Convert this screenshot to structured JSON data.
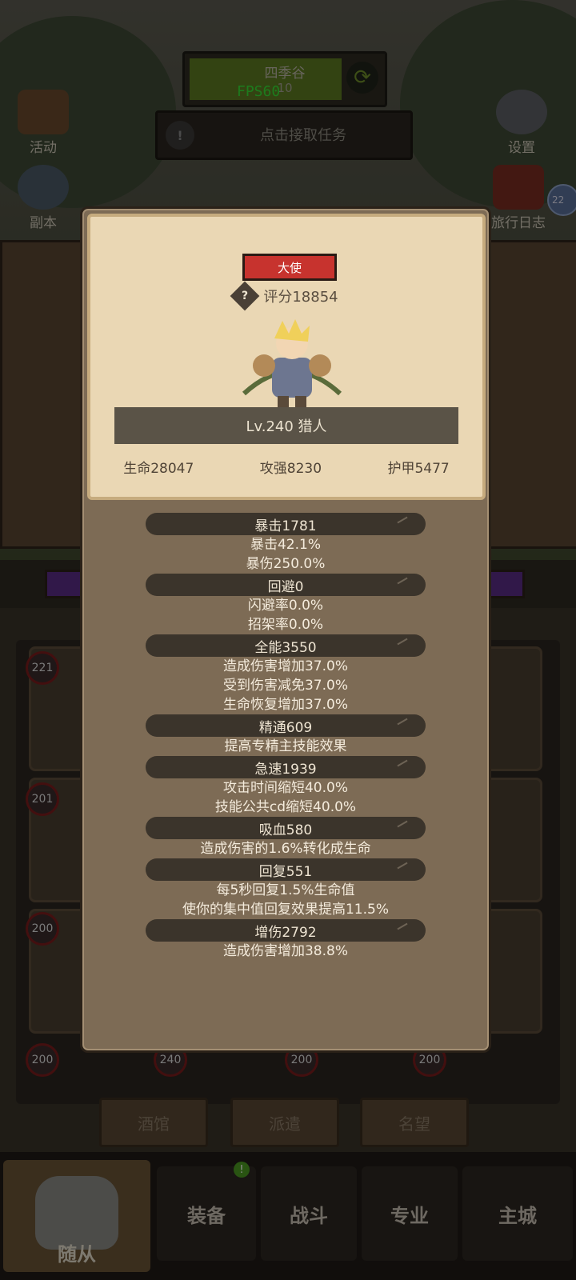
{
  "hud": {
    "zone_name": "四季谷",
    "zone_sub": "10",
    "fps": "FPS60",
    "quest_label": "点击接取任务"
  },
  "side": {
    "left": [
      {
        "label": "活动"
      },
      {
        "label": "副本"
      }
    ],
    "right": [
      {
        "label": "设置"
      },
      {
        "label": "旅行日志"
      }
    ],
    "edge_badge": "22"
  },
  "roster": {
    "levels": [
      "221",
      "201",
      "200",
      "200",
      "240",
      "200",
      "200"
    ]
  },
  "subtabs": [
    "酒馆",
    "派遣",
    "名望"
  ],
  "nav": {
    "items": [
      {
        "label": "随从"
      },
      {
        "label": "装备"
      },
      {
        "label": "战斗"
      },
      {
        "label": "专业"
      },
      {
        "label": "主城"
      }
    ],
    "equip_badge": "!"
  },
  "popup": {
    "rank": "大使",
    "score": "评分18854",
    "level": "Lv.240 猎人",
    "hp": "生命28047",
    "attack": "攻强8230",
    "armor": "护甲5477",
    "stats": [
      {
        "title": "暴击1781",
        "details": [
          "暴击42.1%",
          "暴伤250.0%"
        ]
      },
      {
        "title": "回避0",
        "details": [
          "闪避率0.0%",
          "招架率0.0%"
        ]
      },
      {
        "title": "全能3550",
        "details": [
          "造成伤害增加37.0%",
          "受到伤害减免37.0%",
          "生命恢复增加37.0%"
        ]
      },
      {
        "title": "精通609",
        "details": [
          "提高专精主技能效果"
        ]
      },
      {
        "title": "急速1939",
        "details": [
          "攻击时间缩短40.0%",
          "技能公共cd缩短40.0%"
        ]
      },
      {
        "title": "吸血580",
        "details": [
          "造成伤害的1.6%转化成生命"
        ]
      },
      {
        "title": "回复551",
        "details": [
          "每5秒回复1.5%生命值",
          "使你的集中值回复效果提高11.5%"
        ]
      },
      {
        "title": "增伤2792",
        "details": [
          "造成伤害增加38.8%"
        ]
      }
    ]
  },
  "colors": {
    "rank_red": "#c7332e",
    "fps_green": "#35e035",
    "parchment": "#ead7b4",
    "popup_bg": "#7d6b55"
  }
}
